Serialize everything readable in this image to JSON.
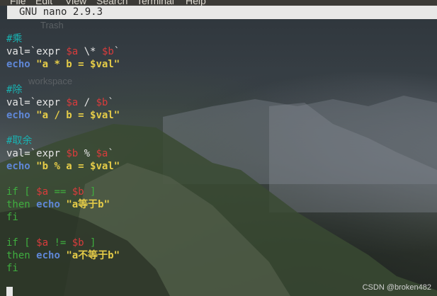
{
  "menubar": {
    "items": [
      "File",
      "Edit",
      "View",
      "Search",
      "Terminal",
      "Help"
    ]
  },
  "titlebar": {
    "title": "GNU nano 2.9.3"
  },
  "desktop": {
    "trash_label": "Trash",
    "workspace_label": "workspace"
  },
  "editor": {
    "mul_comment": "#乘",
    "div_comment": "#除",
    "mod_comment": "#取余",
    "eq_string": "\"a等于b\"",
    "neq_string": "\"a不等于b\""
  },
  "watermark": "CSDN @broken482",
  "colors": {
    "comment": "#19b2b2",
    "keyword": "#5f87d7",
    "string": "#e5cc48",
    "variable": "#d83c3c",
    "control": "#3fae3f",
    "titlebar_bg": "#e8e8e7"
  }
}
